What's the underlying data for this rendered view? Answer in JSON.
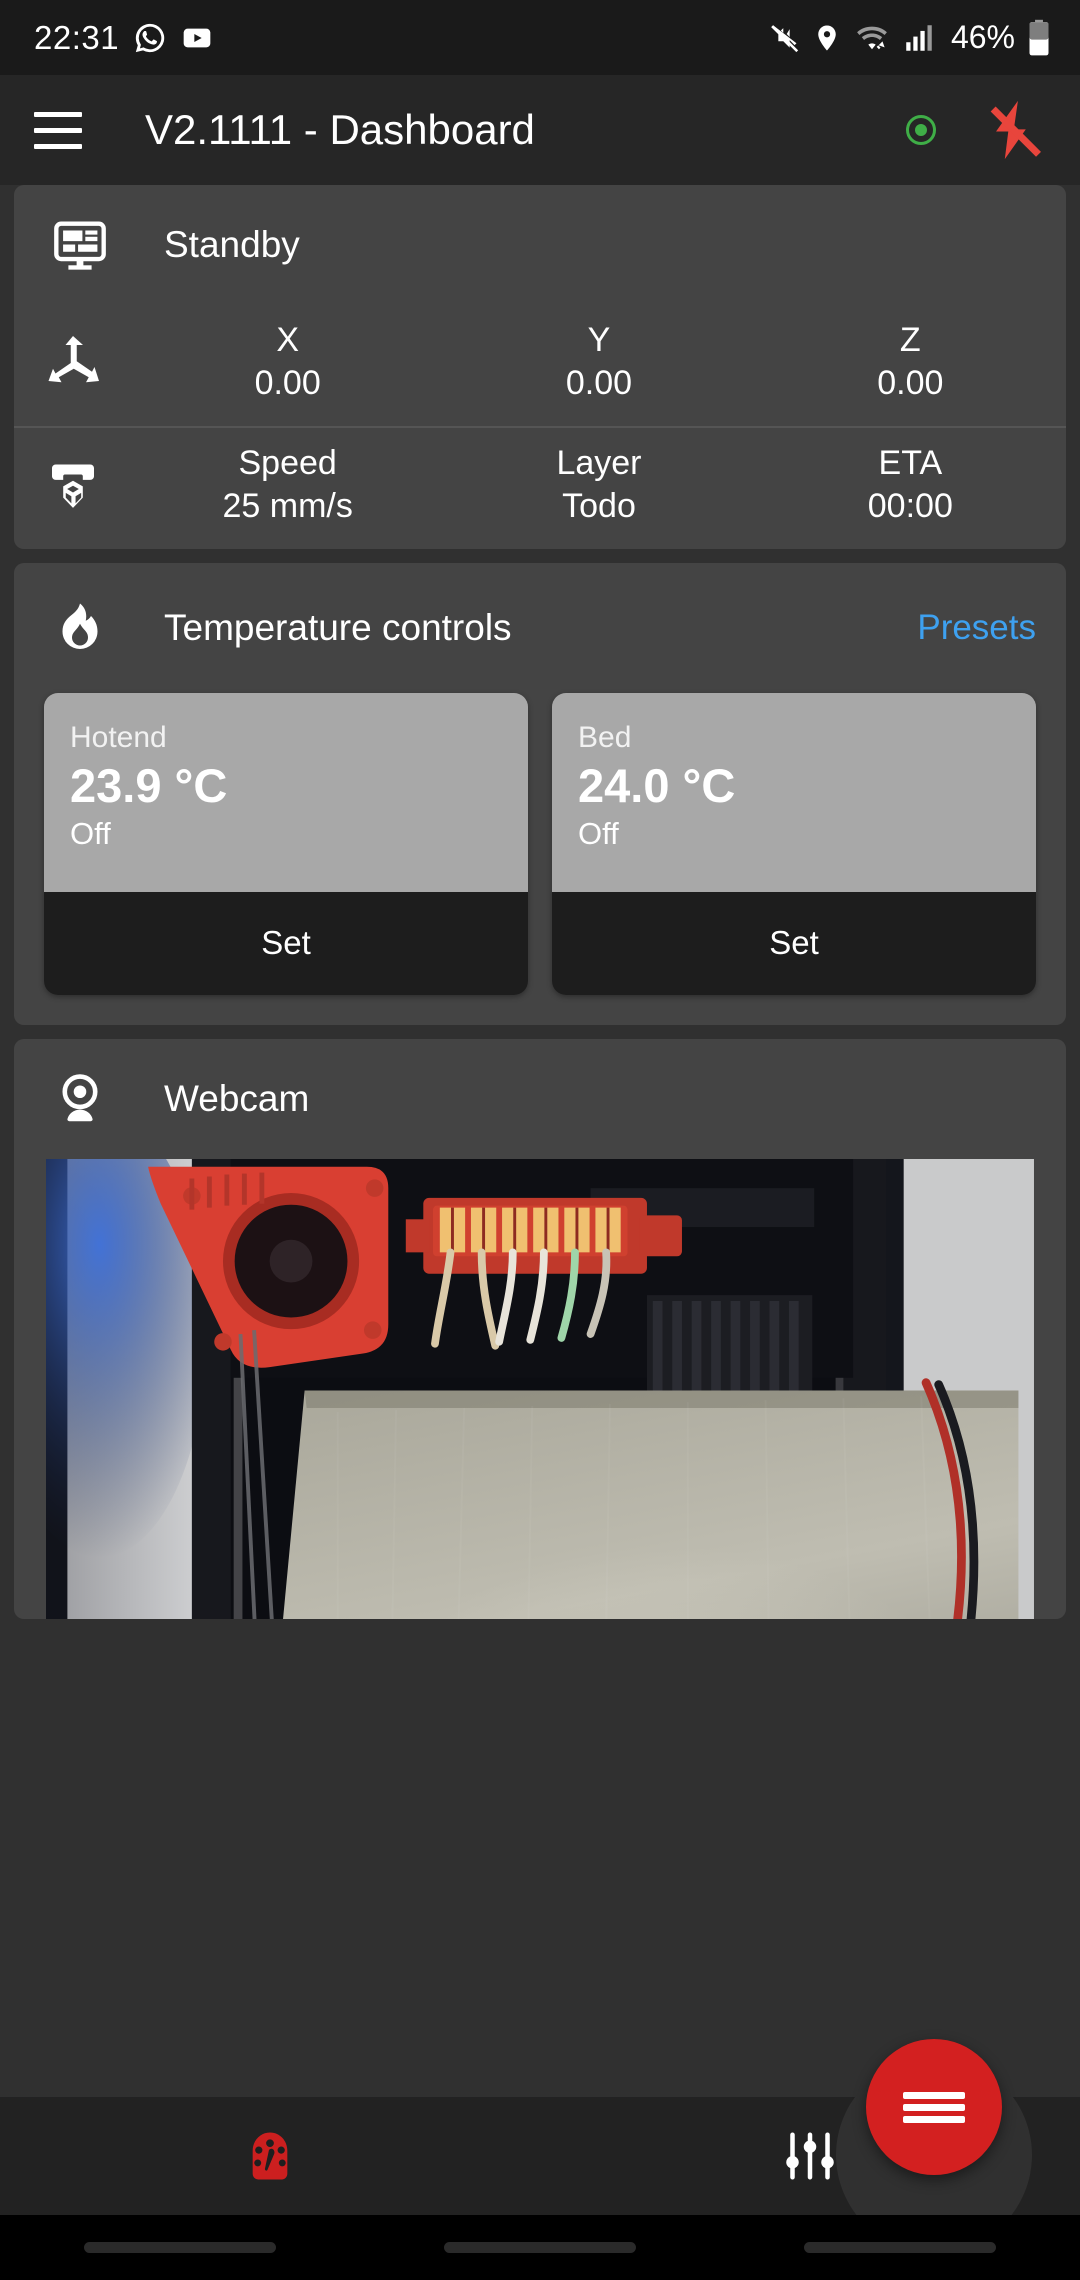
{
  "status_bar": {
    "time": "22:31",
    "left_icons": [
      "whatsapp-icon",
      "youtube-icon"
    ],
    "right_icons": [
      "mute-icon",
      "location-icon",
      "wifi-icon",
      "signal-icon"
    ],
    "battery_percent": "46%"
  },
  "app_bar": {
    "menu_icon": "hamburger-menu-icon",
    "title": "V2.1111 - Dashboard",
    "connection_indicator": "connected-dot-icon",
    "connection_color": "#3fae47",
    "emergency_stop_icon": "flash-off-icon",
    "emergency_stop_color": "#e8453c"
  },
  "status_card": {
    "icon": "dashboard-monitor-icon",
    "state": "Standby",
    "position": {
      "icon": "axis-move-icon",
      "cells": [
        {
          "key": "X",
          "value": "0.00"
        },
        {
          "key": "Y",
          "value": "0.00"
        },
        {
          "key": "Z",
          "value": "0.00"
        }
      ]
    },
    "print": {
      "icon": "printer-3d-icon",
      "cells": [
        {
          "key": "Speed",
          "value": "25 mm/s"
        },
        {
          "key": "Layer",
          "value": "Todo"
        },
        {
          "key": "ETA",
          "value": "00:00"
        }
      ]
    }
  },
  "temperature_card": {
    "icon": "flame-icon",
    "title": "Temperature controls",
    "presets_label": "Presets",
    "presets_color": "#3ea1f0",
    "tiles": [
      {
        "name": "Hotend",
        "value": "23.9 °C",
        "state": "Off",
        "button": "Set"
      },
      {
        "name": "Bed",
        "value": "24.0 °C",
        "state": "Off",
        "button": "Set"
      }
    ]
  },
  "webcam_card": {
    "icon": "webcam-icon",
    "title": "Webcam"
  },
  "bottom_nav": {
    "items": [
      {
        "icon": "dashboard-gauge-icon",
        "active": true,
        "color": "#cc1f1f"
      },
      {
        "icon": "tune-sliders-icon",
        "active": false,
        "color": "#ffffff"
      }
    ],
    "fab": {
      "icon": "menu-fab-icon",
      "color": "#d32020"
    }
  }
}
